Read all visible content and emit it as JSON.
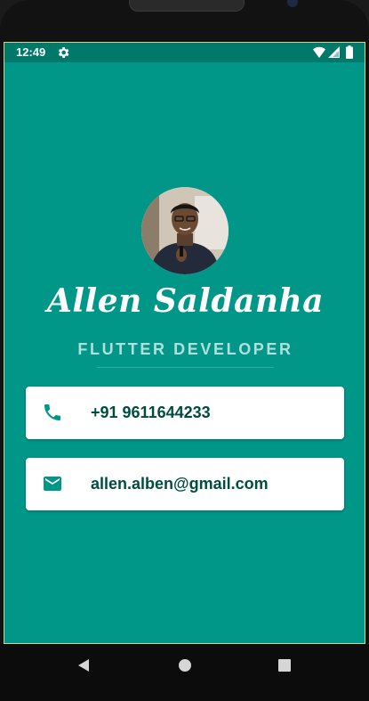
{
  "status_bar": {
    "time": "12:49",
    "icons": [
      "settings-gear-icon",
      "wifi-icon",
      "cell-signal-icon",
      "battery-icon"
    ]
  },
  "profile": {
    "name": "Allen Saldanha",
    "title": "FLUTTER DEVELOPER",
    "avatar": "profile-photo"
  },
  "contacts": [
    {
      "icon": "phone-icon",
      "text": "+91 9611644233"
    },
    {
      "icon": "email-icon",
      "text": "allen.alben@gmail.com"
    }
  ],
  "nav_bar": {
    "buttons": [
      "back-icon",
      "home-icon",
      "recents-icon"
    ]
  },
  "colors": {
    "background": "#009688",
    "status_bar": "#00796b",
    "subtitle": "#b2dfdb",
    "card_text": "#004d40",
    "icon": "#009688"
  }
}
